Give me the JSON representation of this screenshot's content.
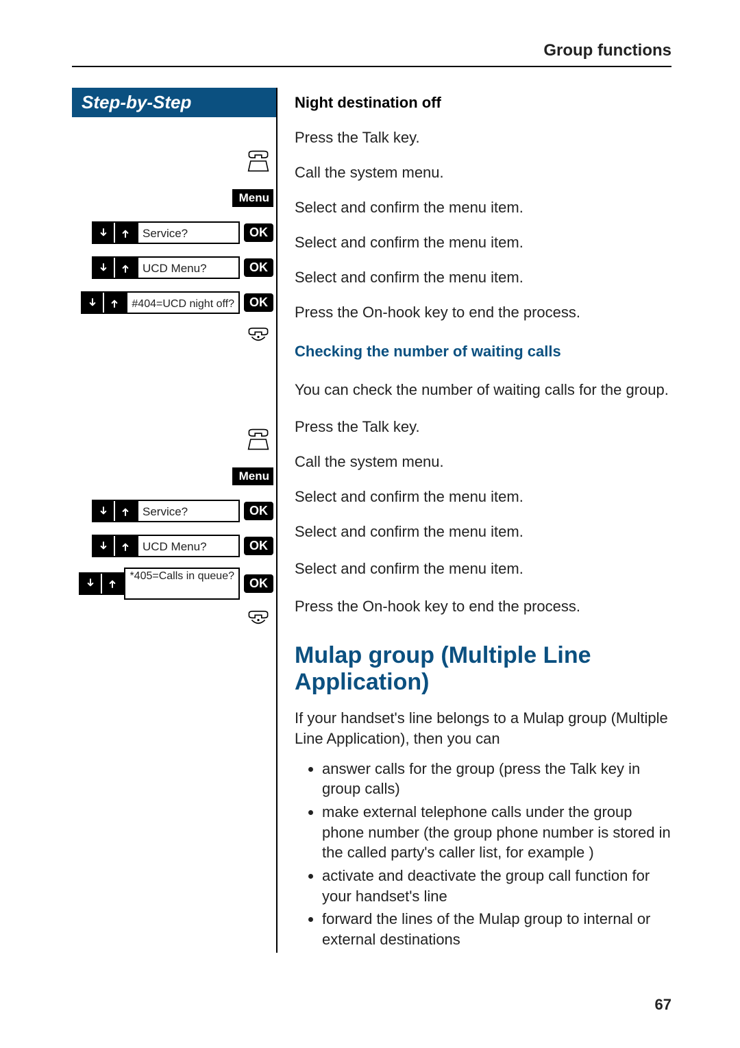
{
  "header": {
    "section": "Group functions"
  },
  "left": {
    "step_header": "Step-by-Step"
  },
  "badges": {
    "menu": "Menu",
    "ok": "OK"
  },
  "menu_items": {
    "service": "Service?",
    "ucd_menu": "UCD Menu?",
    "night_off": "#404=UCD night off?",
    "calls_in_queue": "*405=Calls in queue?"
  },
  "sec1": {
    "title": "Night destination off",
    "r1": "Press the Talk key.",
    "r2": "Call the system menu.",
    "r3": "Select and confirm the menu item.",
    "r4": "Select and confirm the menu item.",
    "r5": "Select and confirm the menu item.",
    "r6": "Press the On-hook key to end the process."
  },
  "sec2": {
    "title": "Checking the number of waiting calls",
    "intro": "You can check the number of waiting calls for the group.",
    "r1": "Press the Talk key.",
    "r2": "Call the system menu.",
    "r3": "Select and confirm the menu item.",
    "r4": "Select and confirm the menu item.",
    "r5": "Select and confirm the menu item.",
    "r6": "Press the On-hook key to end the process."
  },
  "mulap": {
    "title": "Mulap group (Multiple Line Application)",
    "intro": "If your handset's line belongs to a Mulap group (Multiple Line Application), then you can",
    "b1": "answer calls for the group (press the Talk key in group calls)",
    "b2": "make external telephone calls under the group phone number (the group phone number is stored in the called party's caller list, for example )",
    "b3": "activate and deactivate the group call function for your handset's line",
    "b4": "forward the lines of the Mulap group to internal or external destinations"
  },
  "page_number": "67"
}
